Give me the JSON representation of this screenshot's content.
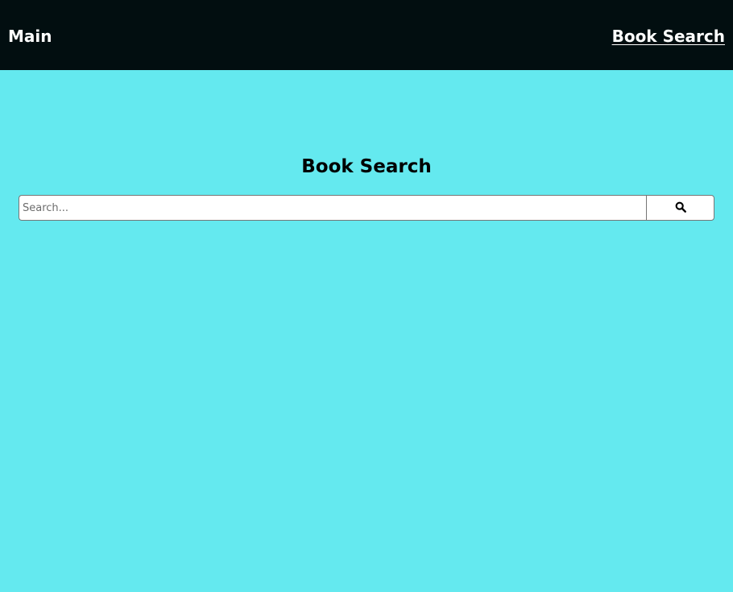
{
  "navbar": {
    "left_link": "Main",
    "right_link": "Book Search"
  },
  "main": {
    "title": "Book Search",
    "search": {
      "placeholder": "Search...",
      "value": "",
      "button_icon": "search-icon"
    }
  },
  "colors": {
    "background": "#64e9ef",
    "navbar": "#020e10",
    "nav_text": "#ffffff",
    "title_text": "#000000"
  }
}
